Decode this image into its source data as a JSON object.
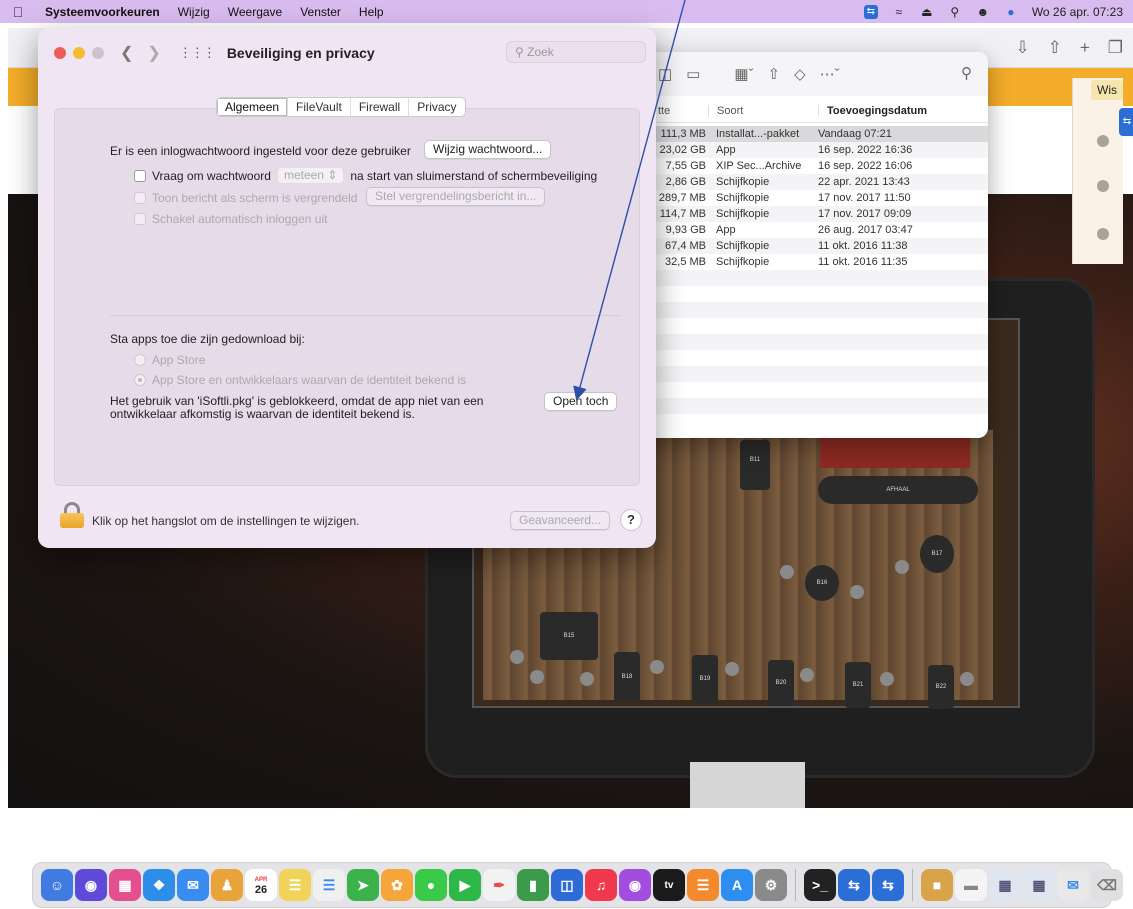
{
  "menubar": {
    "app_name": "Systeemvoorkeuren",
    "items": [
      "Wijzig",
      "Weergave",
      "Venster",
      "Help"
    ],
    "datetime": "Wo 26 apr. 07:23"
  },
  "background": {
    "button_label": "Wis",
    "table_labels": [
      "B11",
      "B15",
      "B16",
      "B17",
      "B18",
      "B19",
      "B20",
      "B21",
      "B22",
      "AFHAAL"
    ]
  },
  "finder": {
    "columns": [
      "tte",
      "Soort",
      "Toevoegingsdatum"
    ],
    "rows": [
      {
        "size": "111,3 MB",
        "kind": "Installat...-pakket",
        "date": "Vandaag 07:21"
      },
      {
        "size": "23,02 GB",
        "kind": "App",
        "date": "16 sep. 2022 16:36"
      },
      {
        "size": "7,55 GB",
        "kind": "XIP Sec...Archive",
        "date": "16 sep. 2022 16:06"
      },
      {
        "size": "2,86 GB",
        "kind": "Schijfkopie",
        "date": "22 apr. 2021 13:43"
      },
      {
        "size": "289,7 MB",
        "kind": "Schijfkopie",
        "date": "17 nov. 2017 11:50"
      },
      {
        "size": "114,7 MB",
        "kind": "Schijfkopie",
        "date": "17 nov. 2017 09:09"
      },
      {
        "size": "9,93 GB",
        "kind": "App",
        "date": "26 aug. 2017 03:47"
      },
      {
        "size": "67,4 MB",
        "kind": "Schijfkopie",
        "date": "11 okt. 2016 11:38"
      },
      {
        "size": "32,5 MB",
        "kind": "Schijfkopie",
        "date": "11 okt. 2016 11:35"
      }
    ]
  },
  "prefs": {
    "title": "Beveiliging en privacy",
    "search_placeholder": "Zoek",
    "tabs": [
      "Algemeen",
      "FileVault",
      "Firewall",
      "Privacy"
    ],
    "password_text": "Er is een inlogwachtwoord ingesteld voor deze gebruiker",
    "change_password_button": "Wijzig wachtwoord...",
    "ask_password_label": "Vraag om wachtwoord",
    "ask_password_value": "meteen",
    "ask_password_suffix": "na start van sluimerstand of schermbeveiliging",
    "show_message_label": "Toon bericht als scherm is vergrendeld",
    "set_message_button": "Stel vergrendelingsbericht in...",
    "auto_login_label": "Schakel automatisch inloggen uit",
    "allow_apps_heading": "Sta apps toe die zijn gedownload bij:",
    "radio_app_store": "App Store",
    "radio_app_store_dev": "App Store en ontwikkelaars waarvan de identiteit bekend is",
    "blocked_message": "Het gebruik van 'iSoftli.pkg' is geblokkeerd, omdat de app niet van een ontwikkelaar afkomstig is waarvan de identiteit bekend is.",
    "open_anyway_button": "Open toch",
    "lock_text": "Klik op het hangslot om de instellingen te wijzigen.",
    "advanced_button": "Geavanceerd...",
    "help_button": "?"
  },
  "dock": {
    "calendar_month": "APR",
    "calendar_day": "26",
    "tv_label": "tv"
  }
}
